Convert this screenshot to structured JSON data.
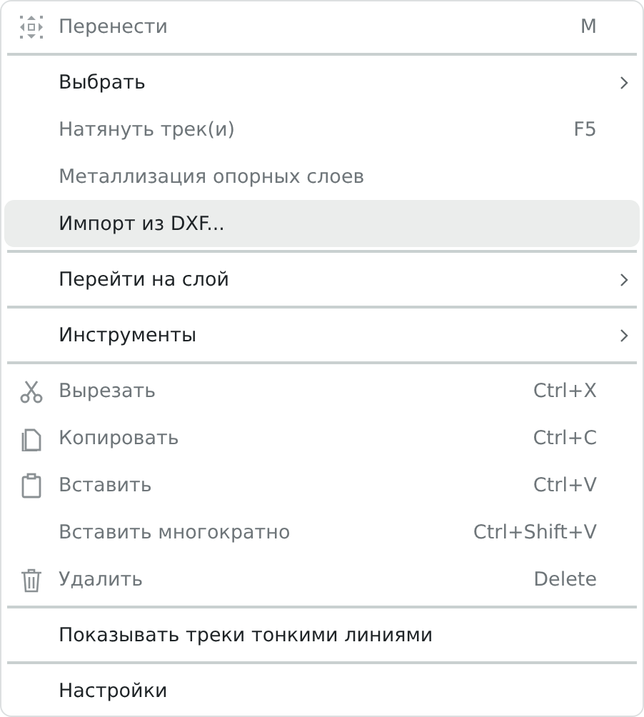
{
  "menu": {
    "groups": [
      [
        {
          "kind": "move",
          "label": "Перенести",
          "shortcut": "M",
          "disabled": true,
          "selected": false
        }
      ],
      [
        {
          "kind": "plain",
          "label": "Выбрать",
          "submenu": true,
          "disabled": false,
          "selected": false
        },
        {
          "kind": "plain",
          "label": "Натянуть трек(и)",
          "shortcut": "F5",
          "disabled": true,
          "selected": false
        },
        {
          "kind": "plain",
          "label": "Металлизация опорных слоев",
          "disabled": true,
          "selected": false
        },
        {
          "kind": "plain",
          "label": "Импорт из DXF...",
          "disabled": false,
          "selected": true
        }
      ],
      [
        {
          "kind": "plain",
          "label": "Перейти на слой",
          "submenu": true,
          "disabled": false,
          "selected": false
        }
      ],
      [
        {
          "kind": "plain",
          "label": "Инструменты",
          "submenu": true,
          "disabled": false,
          "selected": false
        }
      ],
      [
        {
          "kind": "cut",
          "label": "Вырезать",
          "shortcut": "Ctrl+X",
          "disabled": true,
          "selected": false
        },
        {
          "kind": "copy",
          "label": "Копировать",
          "shortcut": "Ctrl+C",
          "disabled": true,
          "selected": false
        },
        {
          "kind": "paste",
          "label": "Вставить",
          "shortcut": "Ctrl+V",
          "disabled": true,
          "selected": false
        },
        {
          "kind": "plain",
          "label": "Вставить многократно",
          "shortcut": "Ctrl+Shift+V",
          "disabled": true,
          "selected": false
        },
        {
          "kind": "delete",
          "label": "Удалить",
          "shortcut": "Delete",
          "disabled": true,
          "selected": false
        }
      ],
      [
        {
          "kind": "plain",
          "label": "Показывать треки тонкими линиями",
          "disabled": false,
          "selected": false
        }
      ],
      [
        {
          "kind": "plain",
          "label": "Настройки",
          "disabled": false,
          "selected": false
        }
      ]
    ]
  }
}
